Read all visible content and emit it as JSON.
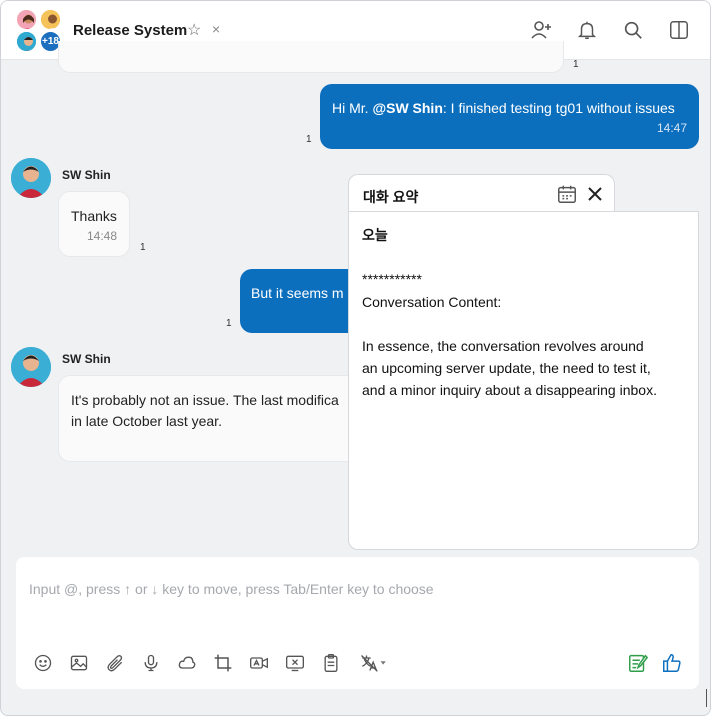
{
  "header": {
    "title": "Release System",
    "member_more": "+18"
  },
  "messages": {
    "m1_read": "1",
    "m2_prefix": "Hi Mr. ",
    "m2_mention": "@SW Shin",
    "m2_rest": ": I finished testing tg01 without issues",
    "m2_time": "14:47",
    "m2_read": "1",
    "m3_sender": "SW Shin",
    "m3_text": "Thanks",
    "m3_time": "14:48",
    "m3_read": "1",
    "m4_text": "But it seems m",
    "m4_read": "1",
    "m5_sender": "SW Shin",
    "m5_line1": "It's probably not an issue. The last modifica",
    "m5_line2": "in late October last year."
  },
  "summary": {
    "title": "대화 요약",
    "date_heading": "오늘",
    "stars": "***********",
    "content_label": "Conversation Content:",
    "line1": "In essence, the conversation revolves around",
    "line2": "an upcoming server update, the need to test it,",
    "line3": "and a minor inquiry about a disappearing inbox."
  },
  "composer": {
    "placeholder": "Input @, press ↑ or ↓ key to move, press Tab/Enter key to choose"
  },
  "colors": {
    "accent": "#0c6fbe",
    "background": "#f0f1f3"
  }
}
